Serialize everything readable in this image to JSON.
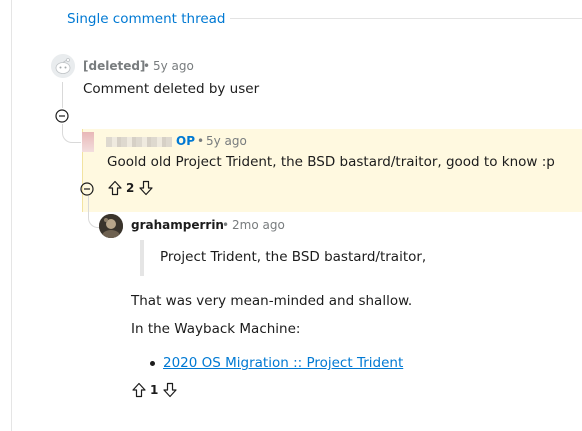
{
  "header": {
    "thread_link": "Single comment thread"
  },
  "comment_deleted": {
    "author": "[deleted]",
    "separator": "•",
    "time": "5y ago",
    "body": "Comment deleted by user",
    "avatar_icon": "snoo-ghost-avatar-icon"
  },
  "comment_op": {
    "badge": "OP",
    "separator": "•",
    "time": "5y ago",
    "body": "Goold old Project Trident, the BSD bastard/traitor, good to know :p",
    "score": "2",
    "highlight_color": "#fff9e0"
  },
  "comment_reply": {
    "author": "grahamperrin",
    "separator": "•",
    "time": "2mo ago",
    "quote": "Project Trident, the BSD bastard/traitor,",
    "paragraph_1": "That was very mean-minded and shallow.",
    "paragraph_2": "In the Wayback Machine:",
    "link": "2020 OS Migration :: Project Trident",
    "score": "1"
  },
  "colors": {
    "accent": "#0079d3",
    "meta": "#787c7e",
    "text": "#1c1c1c"
  }
}
